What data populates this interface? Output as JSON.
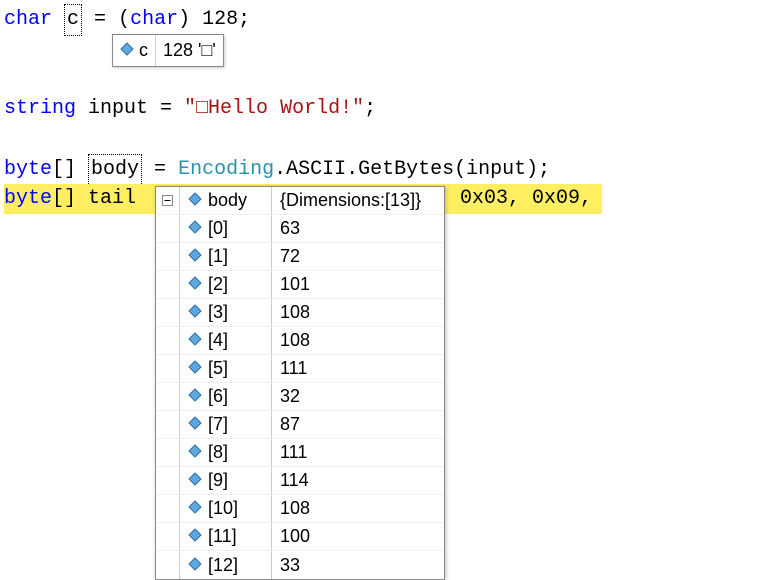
{
  "code": {
    "line1": {
      "kw": "char",
      "space": " ",
      "var": "c",
      "rest": " = (",
      "kw2": "char",
      "rest2": ") 128;"
    },
    "line2": {
      "kw": "string",
      "rest": " input = ",
      "strlit": "\"□Hello World!\"",
      "semi": ";"
    },
    "line3": {
      "kw": "byte",
      "brackets": "[] ",
      "var": "body",
      "rest": " = ",
      "type": "Encoding",
      "rest2": ".ASCII.GetBytes(input);"
    },
    "line4": {
      "kw": "byte",
      "brackets": "[] tail",
      "hex": ", 0x03, 0x09,"
    }
  },
  "datatip_c": {
    "name": "c",
    "value": "128 '□'"
  },
  "inspector": {
    "header": {
      "name": "body",
      "dims": "{Dimensions:[13]}"
    },
    "items": [
      {
        "idx": "[0]",
        "val": "63"
      },
      {
        "idx": "[1]",
        "val": "72"
      },
      {
        "idx": "[2]",
        "val": "101"
      },
      {
        "idx": "[3]",
        "val": "108"
      },
      {
        "idx": "[4]",
        "val": "108"
      },
      {
        "idx": "[5]",
        "val": "111"
      },
      {
        "idx": "[6]",
        "val": "32"
      },
      {
        "idx": "[7]",
        "val": "87"
      },
      {
        "idx": "[8]",
        "val": "111"
      },
      {
        "idx": "[9]",
        "val": "114"
      },
      {
        "idx": "[10]",
        "val": "108"
      },
      {
        "idx": "[11]",
        "val": "100"
      },
      {
        "idx": "[12]",
        "val": "33"
      }
    ]
  }
}
